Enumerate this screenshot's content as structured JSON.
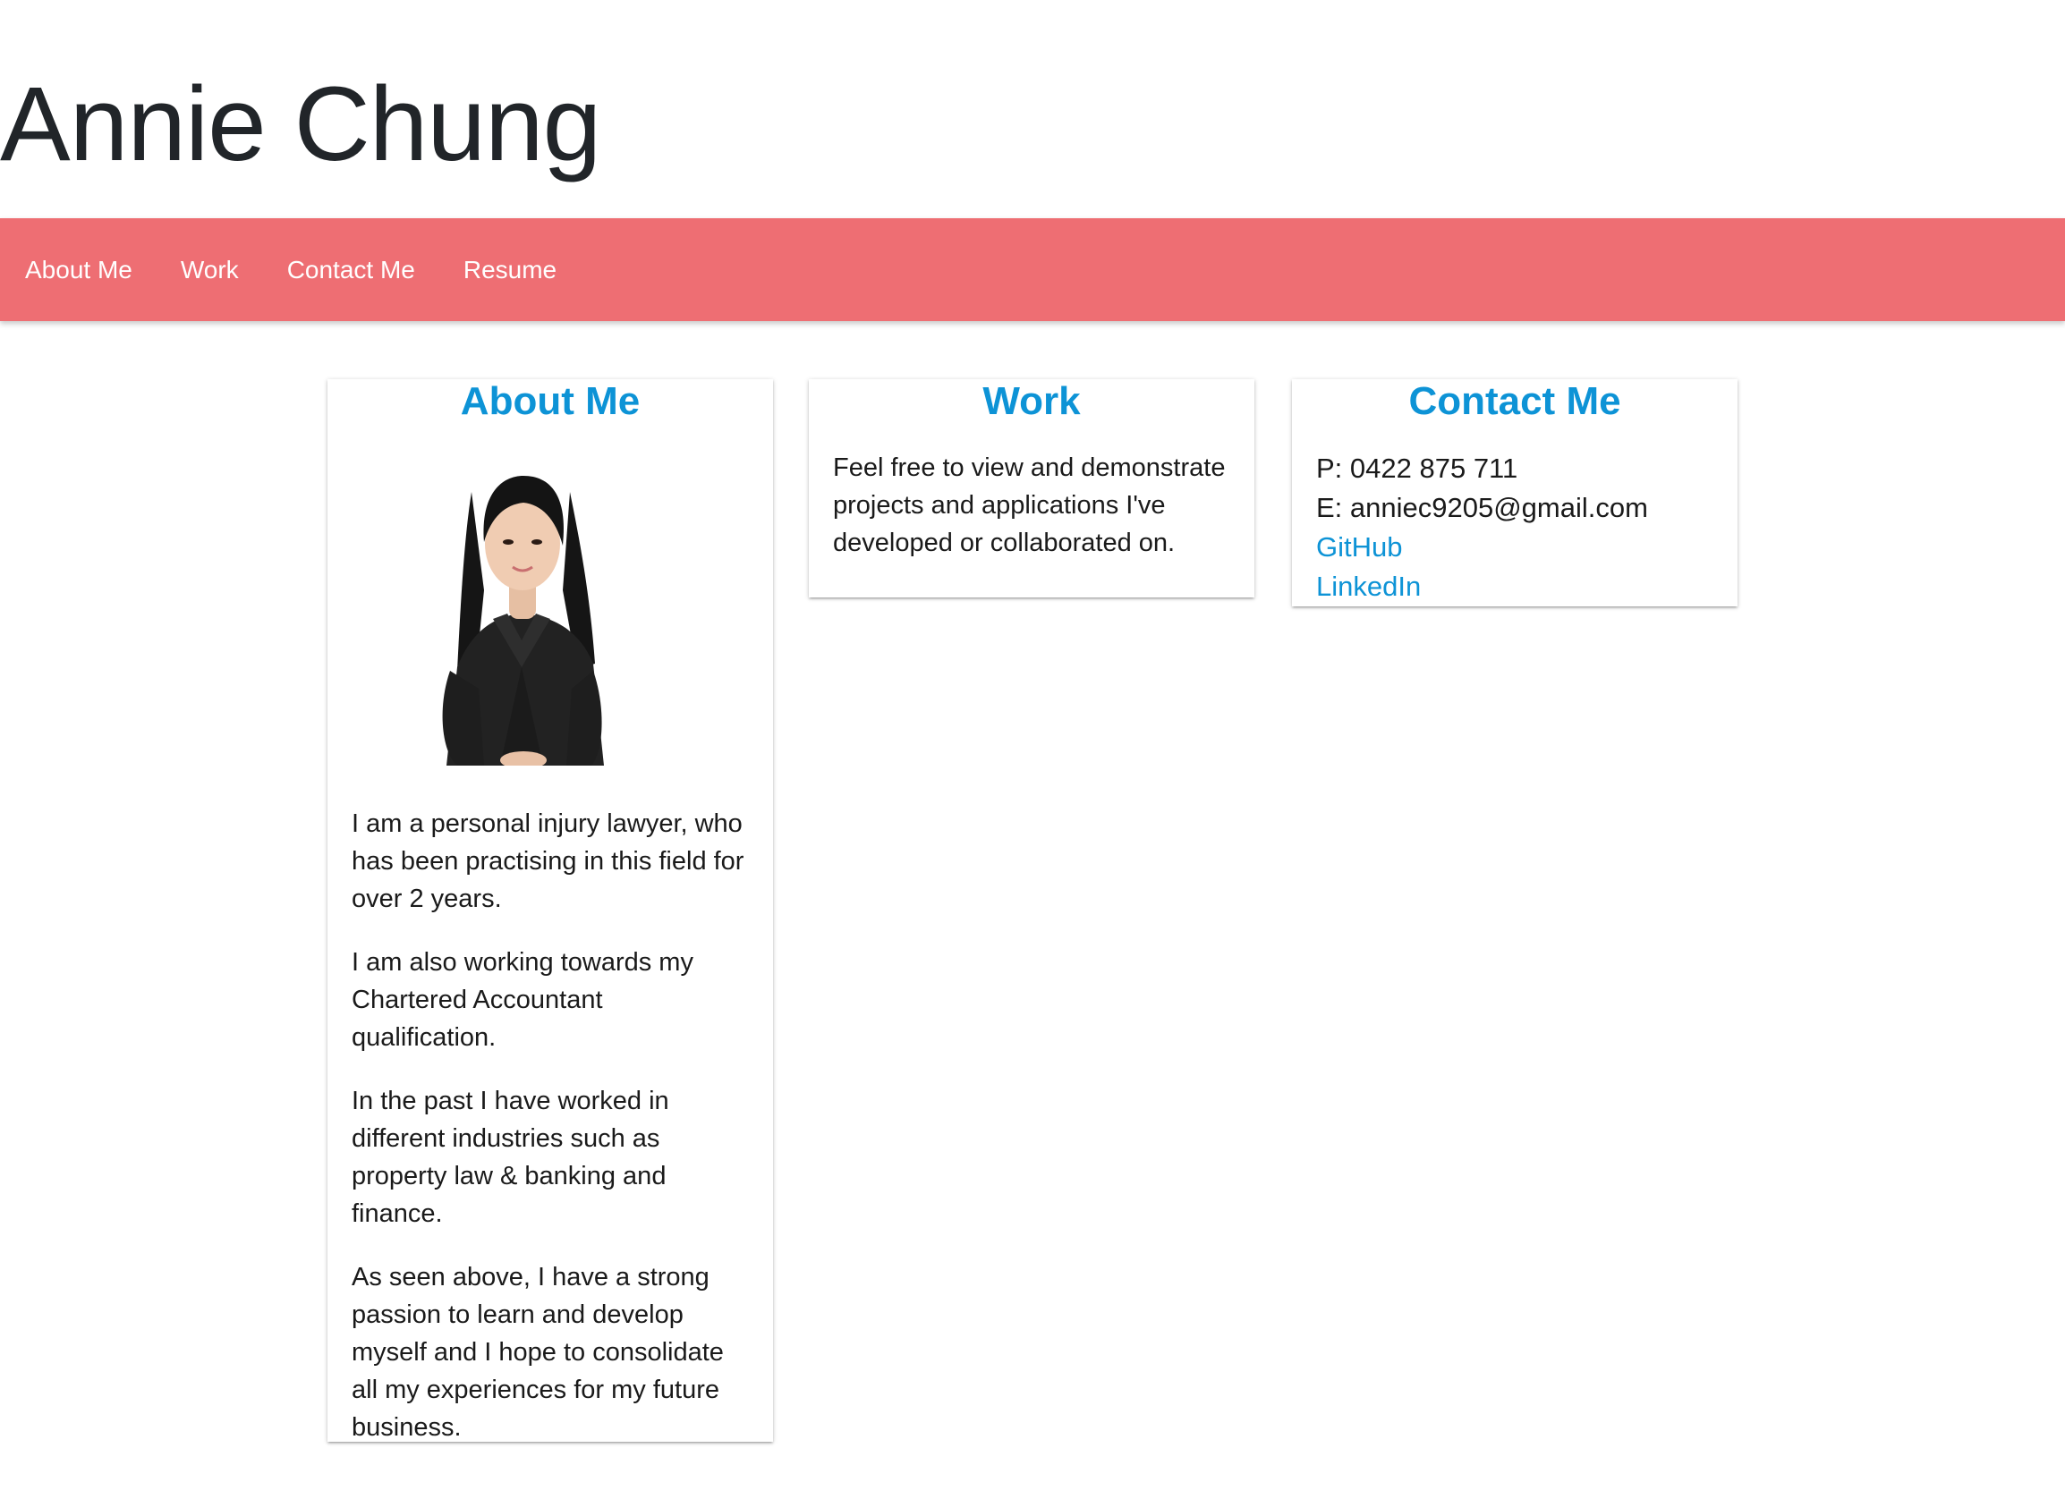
{
  "header": {
    "title": "Annie Chung"
  },
  "nav": {
    "items": [
      {
        "label": "About Me"
      },
      {
        "label": "Work"
      },
      {
        "label": "Contact Me"
      },
      {
        "label": "Resume"
      }
    ],
    "background": "#ee6e73"
  },
  "about": {
    "title": "About Me",
    "paragraphs": [
      "I am a personal injury lawyer, who has been practising in this field for over 2 years.",
      "I am also working towards my Chartered Accountant qualification.",
      "In the past I have worked in different industries such as property law & banking and finance.",
      "As seen above, I have a strong passion to learn and develop myself and I hope to consolidate all my experiences for my future business."
    ]
  },
  "work": {
    "title": "Work",
    "text": "Feel free to view and demonstrate projects and applications I've developed or collaborated on."
  },
  "contact": {
    "title": "Contact Me",
    "phone": "P: 0422 875 711",
    "email": "E: anniec9205@gmail.com",
    "github": "GitHub",
    "linkedin": "LinkedIn"
  },
  "colors": {
    "accent": "#0d93d6",
    "nav": "#ee6e73",
    "text": "#212529"
  }
}
